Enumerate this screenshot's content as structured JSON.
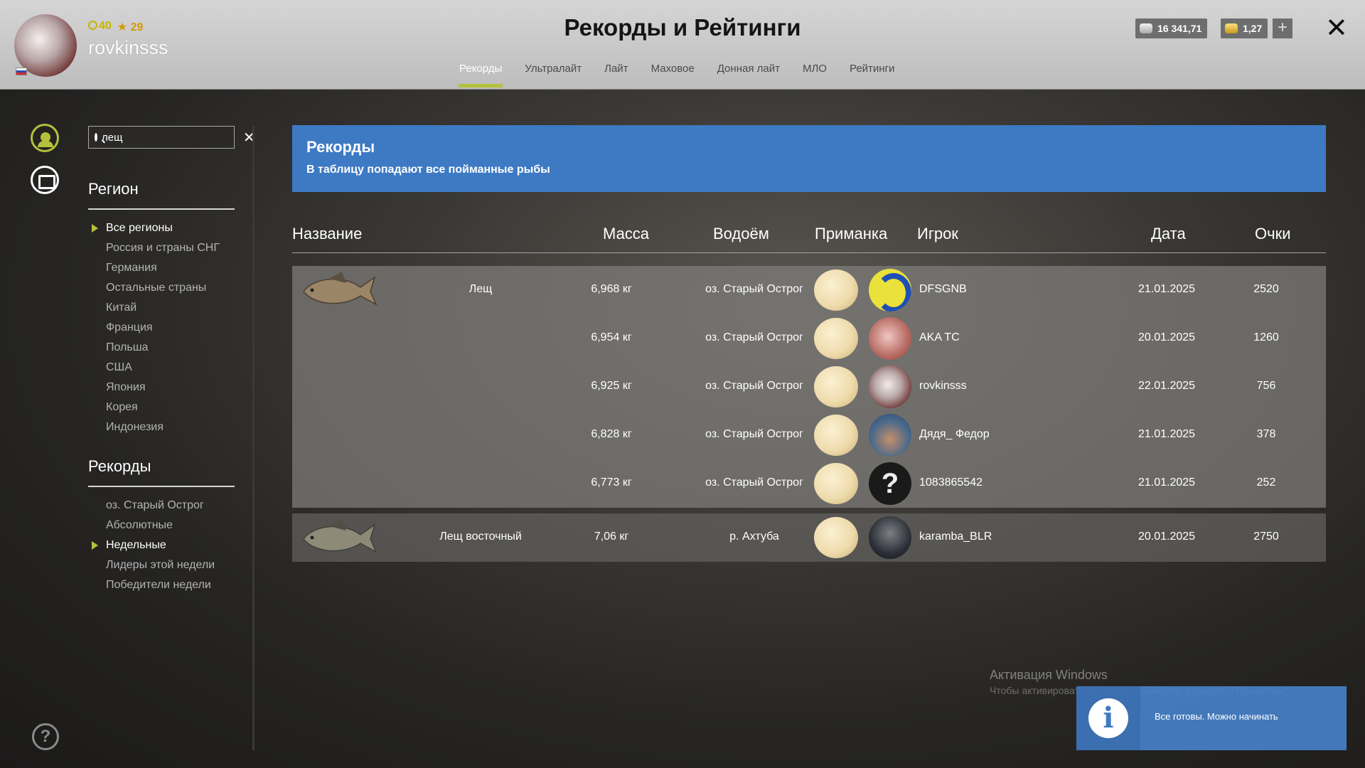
{
  "header": {
    "username": "rovkinsss",
    "level": "40",
    "stars": "29",
    "title": "Рекорды и Рейтинги",
    "silver": "16 341,71",
    "gold": "1,27",
    "plus": "+",
    "close": "✕"
  },
  "tabs": [
    {
      "label": "Рекорды",
      "active": true
    },
    {
      "label": "Ультралайт"
    },
    {
      "label": "Лайт"
    },
    {
      "label": "Маховое"
    },
    {
      "label": "Донная лайт"
    },
    {
      "label": "МЛО"
    },
    {
      "label": "Рейтинги"
    }
  ],
  "search": {
    "value": "лещ"
  },
  "sidebar": {
    "region_title": "Регион",
    "regions": [
      "Все регионы",
      "Россия и страны СНГ",
      "Германия",
      "Остальные страны",
      "Китай",
      "Франция",
      "Польша",
      "США",
      "Япония",
      "Корея",
      "Индонезия"
    ],
    "records_title": "Рекорды",
    "records": [
      "оз. Старый Острог",
      "Абсолютные",
      "Недельные",
      "Лидеры этой недели",
      "Победители недели"
    ]
  },
  "banner": {
    "title": "Рекорды",
    "subtitle": "В таблицу попадают все пойманные рыбы"
  },
  "table": {
    "headers": {
      "name": "Название",
      "mass": "Масса",
      "water": "Водоём",
      "bait": "Приманка",
      "player": "Игрок",
      "date": "Дата",
      "points": "Очки"
    },
    "groups": [
      {
        "fish": "Лещ",
        "rows": [
          {
            "mass": "6,968 кг",
            "water": "оз. Старый Острог",
            "player": "DFSGNB",
            "date": "21.01.2025",
            "points": "2520"
          },
          {
            "mass": "6,954 кг",
            "water": "оз. Старый Острог",
            "player": "AKA TC",
            "date": "20.01.2025",
            "points": "1260"
          },
          {
            "mass": "6,925 кг",
            "water": "оз. Старый Острог",
            "player": "rovkinsss",
            "date": "22.01.2025",
            "points": "756"
          },
          {
            "mass": "6,828 кг",
            "water": "оз. Старый Острог",
            "player": "Дядя_ Федор",
            "date": "21.01.2025",
            "points": "378"
          },
          {
            "mass": "6,773 кг",
            "water": "оз. Старый Острог",
            "player": "1083865542",
            "date": "21.01.2025",
            "points": "252"
          }
        ]
      },
      {
        "fish": "Лещ восточный",
        "rows": [
          {
            "mass": "7,06 кг",
            "water": "р. Ахтуба",
            "player": "karamba_BLR",
            "date": "20.01.2025",
            "points": "2750"
          }
        ]
      }
    ]
  },
  "watermark": {
    "title": "Активация Windows",
    "subtitle": "Чтобы активировать Windows, перейдите в раздел \"Параметры\"."
  },
  "toast": {
    "text": "Все готовы. Можно начинать"
  },
  "colors": {
    "accent": "#b5c13b",
    "banner": "#3e7ac4",
    "topbar": "#c9c9c9"
  }
}
